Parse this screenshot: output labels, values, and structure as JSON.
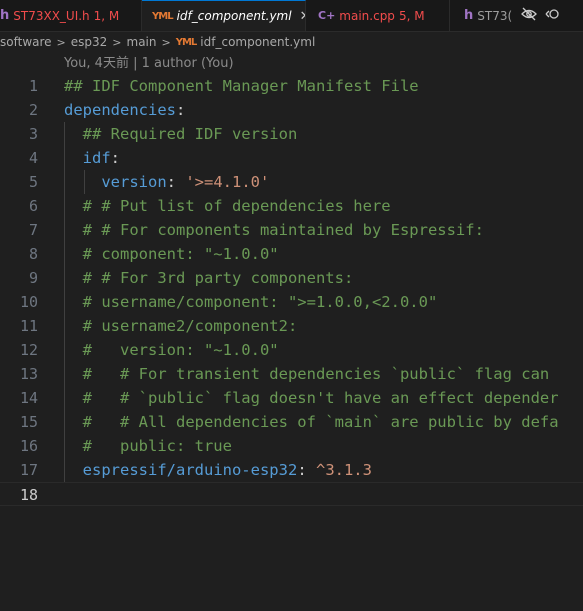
{
  "tabs": [
    {
      "icon": "h",
      "name": "ST73XX_UI.h",
      "status": "1, M",
      "name_color": "#f14c4c",
      "status_color": "#f14c4c",
      "active": false
    },
    {
      "icon": "yml",
      "name": "idf_component.yml",
      "status": "",
      "name_color": "#ffffff",
      "status_color": "#ffffff",
      "active": true,
      "close": "✕"
    },
    {
      "icon": "cpp",
      "name": "main.cpp",
      "status": "5, M",
      "name_color": "#f14c4c",
      "status_color": "#f14c4c",
      "active": false
    },
    {
      "icon": "h",
      "name": "ST73(",
      "status": "",
      "name_color": "#9d9d9d",
      "status_color": "#9d9d9d",
      "active": false
    }
  ],
  "breadcrumb": [
    "software",
    "esp32",
    "main",
    "idf_component.yml"
  ],
  "blame": "You, 4天前 | 1 author (You)",
  "editor": {
    "current_line": 18,
    "lines": [
      {
        "n": "1",
        "text": "## IDF Component Manager Manifest File"
      },
      {
        "n": "2",
        "key": "dependencies",
        "colon": ":"
      },
      {
        "n": "3",
        "text": "  ## Required IDF version"
      },
      {
        "n": "4",
        "indent": "  ",
        "key": "idf",
        "colon": ":"
      },
      {
        "n": "5",
        "indent": "    ",
        "key": "version",
        "colon": ": ",
        "value": "'>=4.1.0'"
      },
      {
        "n": "6",
        "text": "  # # Put list of dependencies here"
      },
      {
        "n": "7",
        "text": "  # # For components maintained by Espressif:"
      },
      {
        "n": "8",
        "text": "  # component: \"~1.0.0\""
      },
      {
        "n": "9",
        "text": "  # # For 3rd party components:"
      },
      {
        "n": "10",
        "text": "  # username/component: \">=1.0.0,<2.0.0\""
      },
      {
        "n": "11",
        "text": "  # username2/component2:"
      },
      {
        "n": "12",
        "text": "  #   version: \"~1.0.0\""
      },
      {
        "n": "13",
        "text": "  #   # For transient dependencies `public` flag can"
      },
      {
        "n": "14",
        "text": "  #   # `public` flag doesn't have an effect depender"
      },
      {
        "n": "15",
        "text": "  #   # All dependencies of `main` are public by defa"
      },
      {
        "n": "16",
        "text": "  #   public: true"
      },
      {
        "n": "17",
        "indent": "  ",
        "key": "espressif/arduino-esp32",
        "colon": ": ",
        "value": "^3.1.3"
      },
      {
        "n": "18",
        "text": ""
      }
    ]
  },
  "colors": {
    "comment": "#6a9955",
    "key": "#569cd6",
    "string": "#ce9178",
    "text": "#cccccc",
    "accent": "#0078d4"
  },
  "icons": [
    "h-file-icon",
    "yaml-file-icon",
    "cpp-file-icon",
    "close-icon",
    "eye-off-icon",
    "go-to-changes-icon"
  ]
}
